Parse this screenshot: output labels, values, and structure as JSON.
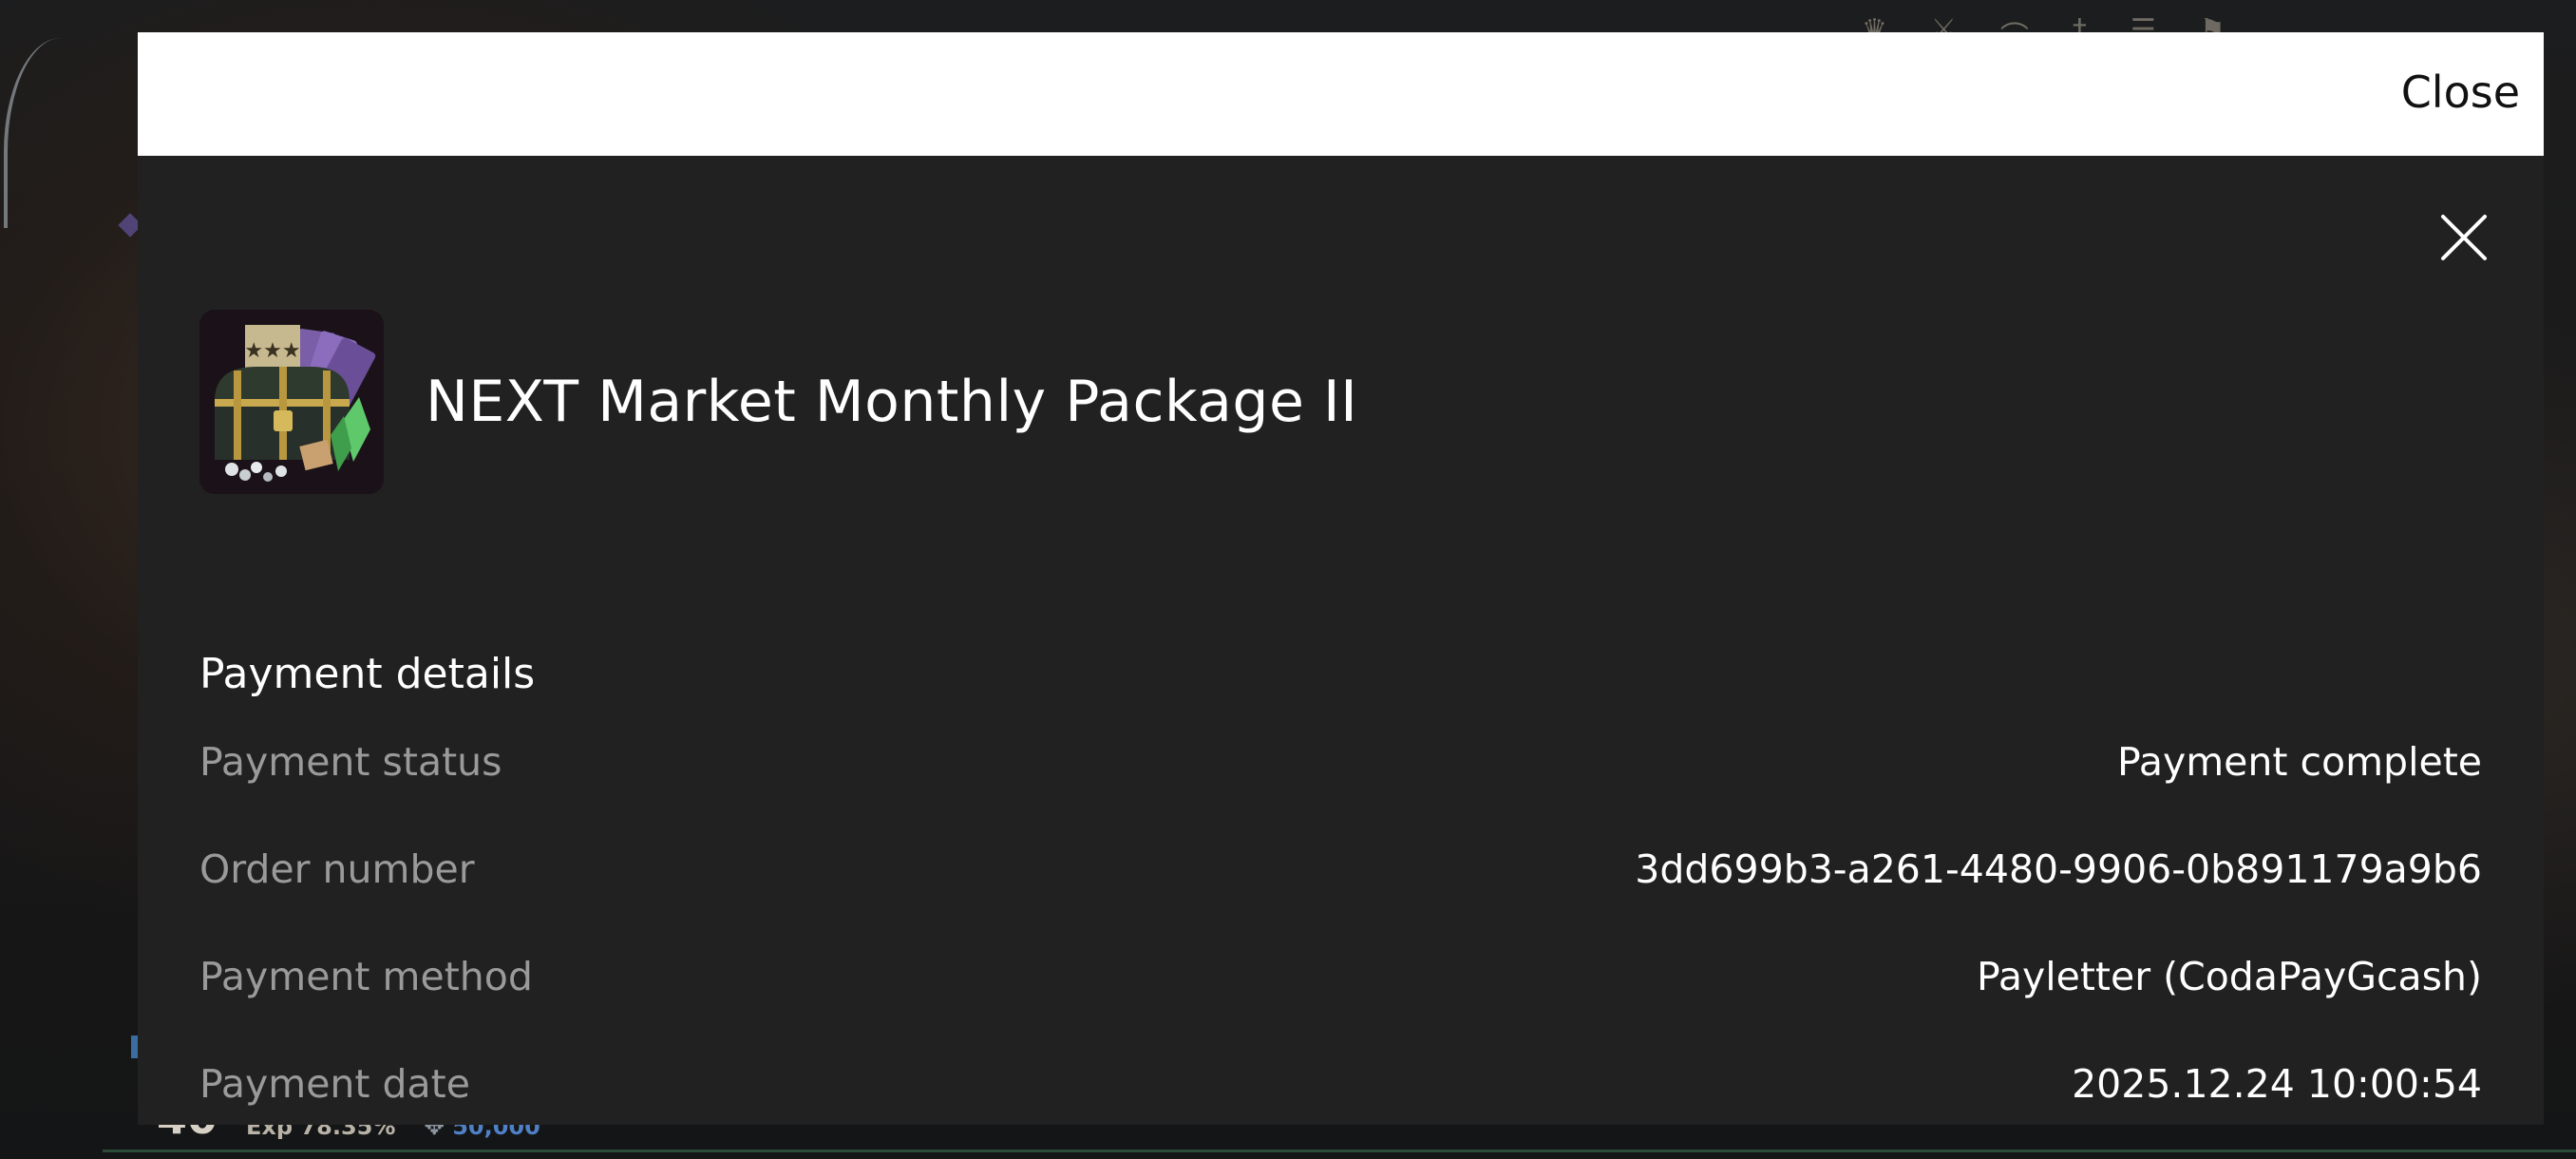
{
  "hud": {
    "level": "40",
    "exp": "Exp 78.35%",
    "currency": "50,000"
  },
  "modal": {
    "close_label": "Close",
    "product_name": "NEXT Market Monthly Package II",
    "section_title": "Payment details",
    "details": [
      {
        "label": "Payment status",
        "value": "Payment complete"
      },
      {
        "label": "Order number",
        "value": "3dd699b3-a261-4480-9906-0b891179a9b6"
      },
      {
        "label": "Payment method",
        "value": "Payletter (CodaPayGcash)"
      },
      {
        "label": "Payment date",
        "value": "2025.12.24 10:00:54"
      }
    ]
  },
  "colors": {
    "modal_bg": "#212121",
    "header_bg": "#ffffff",
    "label_text": "#9a9a9a",
    "value_text": "#ffffff"
  },
  "icons": {
    "close": "close-icon",
    "product": "treasure-chest-icon"
  }
}
